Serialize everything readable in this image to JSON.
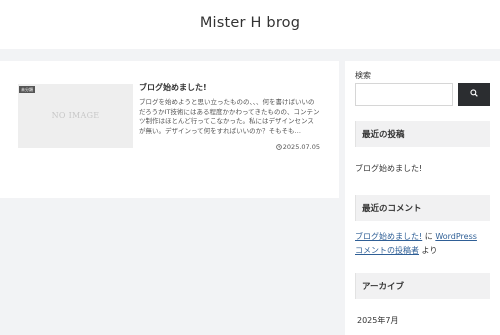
{
  "header": {
    "site_title": "Mister H brog"
  },
  "post": {
    "category": "未分類",
    "thumbnail_text": "NO IMAGE",
    "title": "ブログ始めました!",
    "excerpt": "ブログを始めようと思い立ったものの、、、何を書けばいいのだろうかIT技術にはある程度かかわってきたものの、コンテンツ制作はほとんど行ってこなかった。私にはデザインセンスが無い。デザインって何をすればいいのか？そもそも…",
    "date_icon": "clock-icon",
    "date": "2025.07.05"
  },
  "sidebar": {
    "search": {
      "label": "検索",
      "value": "",
      "button_icon": "search-icon"
    },
    "recent_posts": {
      "heading": "最近の投稿",
      "items": [
        "ブログ始めました!"
      ]
    },
    "recent_comments": {
      "heading": "最近のコメント",
      "items": [
        {
          "post_link": "ブログ始めました!",
          "middle": " に ",
          "author_link_1": "WordPress",
          "author_link_2": "コメントの投稿者",
          "suffix": " より"
        }
      ]
    },
    "archives": {
      "heading": "アーカイブ",
      "items": [
        "2025年7月"
      ]
    }
  },
  "colors": {
    "page_bg": "#f2f3f5",
    "card_bg": "#ffffff",
    "link": "#2f5f96",
    "button": "#2b2d30"
  }
}
